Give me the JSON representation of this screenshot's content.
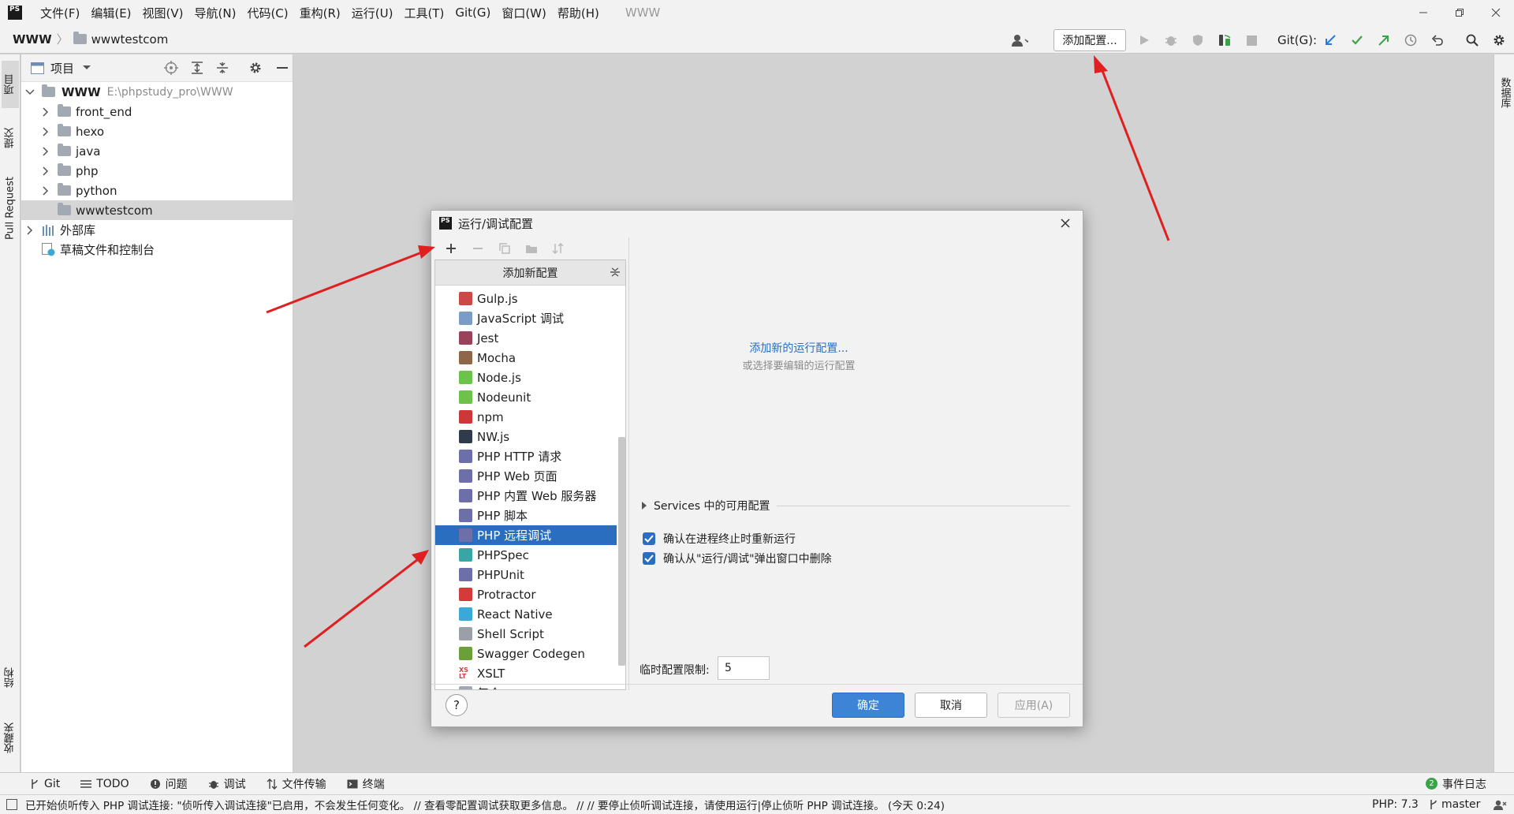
{
  "menubar": {
    "logo": "PS",
    "items": [
      "文件(F)",
      "编辑(E)",
      "视图(V)",
      "导航(N)",
      "代码(C)",
      "重构(R)",
      "运行(U)",
      "工具(T)",
      "Git(G)",
      "窗口(W)",
      "帮助(H)"
    ],
    "project_title": "WWW"
  },
  "navbar": {
    "root": "WWW",
    "current": "wwwtestcom",
    "add_config": "添加配置...",
    "git_label": "Git(G):"
  },
  "left_strip": {
    "project": "项目",
    "commit": "提交",
    "pull_request": "Pull Request",
    "structure": "结构",
    "favorites": "收藏夹"
  },
  "right_strip": {
    "database": "数据库"
  },
  "project_panel": {
    "title": "项目",
    "root_name": "WWW",
    "root_path": "E:\\phpstudy_pro\\WWW",
    "folders": [
      "front_end",
      "hexo",
      "java",
      "php",
      "python",
      "wwwtestcom"
    ],
    "external_libs": "外部库",
    "scratches": "草稿文件和控制台"
  },
  "dialog": {
    "logo": "PS",
    "title": "运行/调试配置",
    "list_header": "添加新配置",
    "items": [
      {
        "label": "Gulp.js",
        "icon": "gulp-icon",
        "color": "#cf4647"
      },
      {
        "label": "JavaScript 调试",
        "icon": "js-debug-icon",
        "color": "#7a9cc6"
      },
      {
        "label": "Jest",
        "icon": "jest-icon",
        "color": "#99425b"
      },
      {
        "label": "Mocha",
        "icon": "mocha-icon",
        "color": "#8d6748"
      },
      {
        "label": "Node.js",
        "icon": "nodejs-icon",
        "color": "#6cc24a"
      },
      {
        "label": "Nodeunit",
        "icon": "nodeunit-icon",
        "color": "#6cc24a"
      },
      {
        "label": "npm",
        "icon": "npm-icon",
        "color": "#cb3837"
      },
      {
        "label": "NW.js",
        "icon": "nwjs-icon",
        "color": "#2f3a4a"
      },
      {
        "label": "PHP HTTP 请求",
        "icon": "php-http-icon",
        "color": "#6d6fa8"
      },
      {
        "label": "PHP Web 页面",
        "icon": "php-web-icon",
        "color": "#6d6fa8"
      },
      {
        "label": "PHP 内置 Web 服务器",
        "icon": "php-server-icon",
        "color": "#6d6fa8"
      },
      {
        "label": "PHP 脚本",
        "icon": "php-script-icon",
        "color": "#6d6fa8"
      },
      {
        "label": "PHP 远程调试",
        "icon": "php-remote-debug-icon",
        "color": "#6d6fa8"
      },
      {
        "label": "PHPSpec",
        "icon": "phpspec-icon",
        "color": "#39a5a5"
      },
      {
        "label": "PHPUnit",
        "icon": "phpunit-icon",
        "color": "#6d6fa8"
      },
      {
        "label": "Protractor",
        "icon": "protractor-icon",
        "color": "#d53a3a"
      },
      {
        "label": "React Native",
        "icon": "react-icon",
        "color": "#3aa9d6"
      },
      {
        "label": "Shell Script",
        "icon": "shell-icon",
        "color": "#9aa0a6"
      },
      {
        "label": "Swagger Codegen",
        "icon": "swagger-icon",
        "color": "#6a9f3a"
      },
      {
        "label": "XSLT",
        "icon": "xslt-icon",
        "color": "#d53a3a"
      },
      {
        "label": "复合",
        "icon": "compound-icon",
        "color": "#a3a9b3"
      }
    ],
    "selected_index": 12,
    "xslt_glyph": "XS LT",
    "add_new_link": "添加新的运行配置...",
    "hint": "或选择要编辑的运行配置",
    "services_label": "Services 中的可用配置",
    "checkbox1": "确认在进程终止时重新运行",
    "checkbox2": "确认从\"运行/调试\"弹出窗口中删除",
    "temp_limit_label": "临时配置限制:",
    "temp_limit_value": "5",
    "ok": "确定",
    "cancel": "取消",
    "apply": "应用(A)",
    "help": "?"
  },
  "bottom_tabs": [
    "Git",
    "TODO",
    "问题",
    "调试",
    "文件传输",
    "终端"
  ],
  "event_log": {
    "count": "2",
    "label": "事件日志"
  },
  "status": {
    "message": "已开始侦听传入 PHP 调试连接: \"侦听传入调试连接\"已启用，不会发生任何变化。 // 查看零配置调试获取更多信息。 // // 要停止侦听调试连接，请使用运行|停止侦听 PHP 调试连接。 (今天 0:24)",
    "php_version": "PHP: 7.3",
    "branch": "master"
  },
  "colors": {
    "accent": "#2a6ebf",
    "annotation_arrow": "#e02020"
  }
}
